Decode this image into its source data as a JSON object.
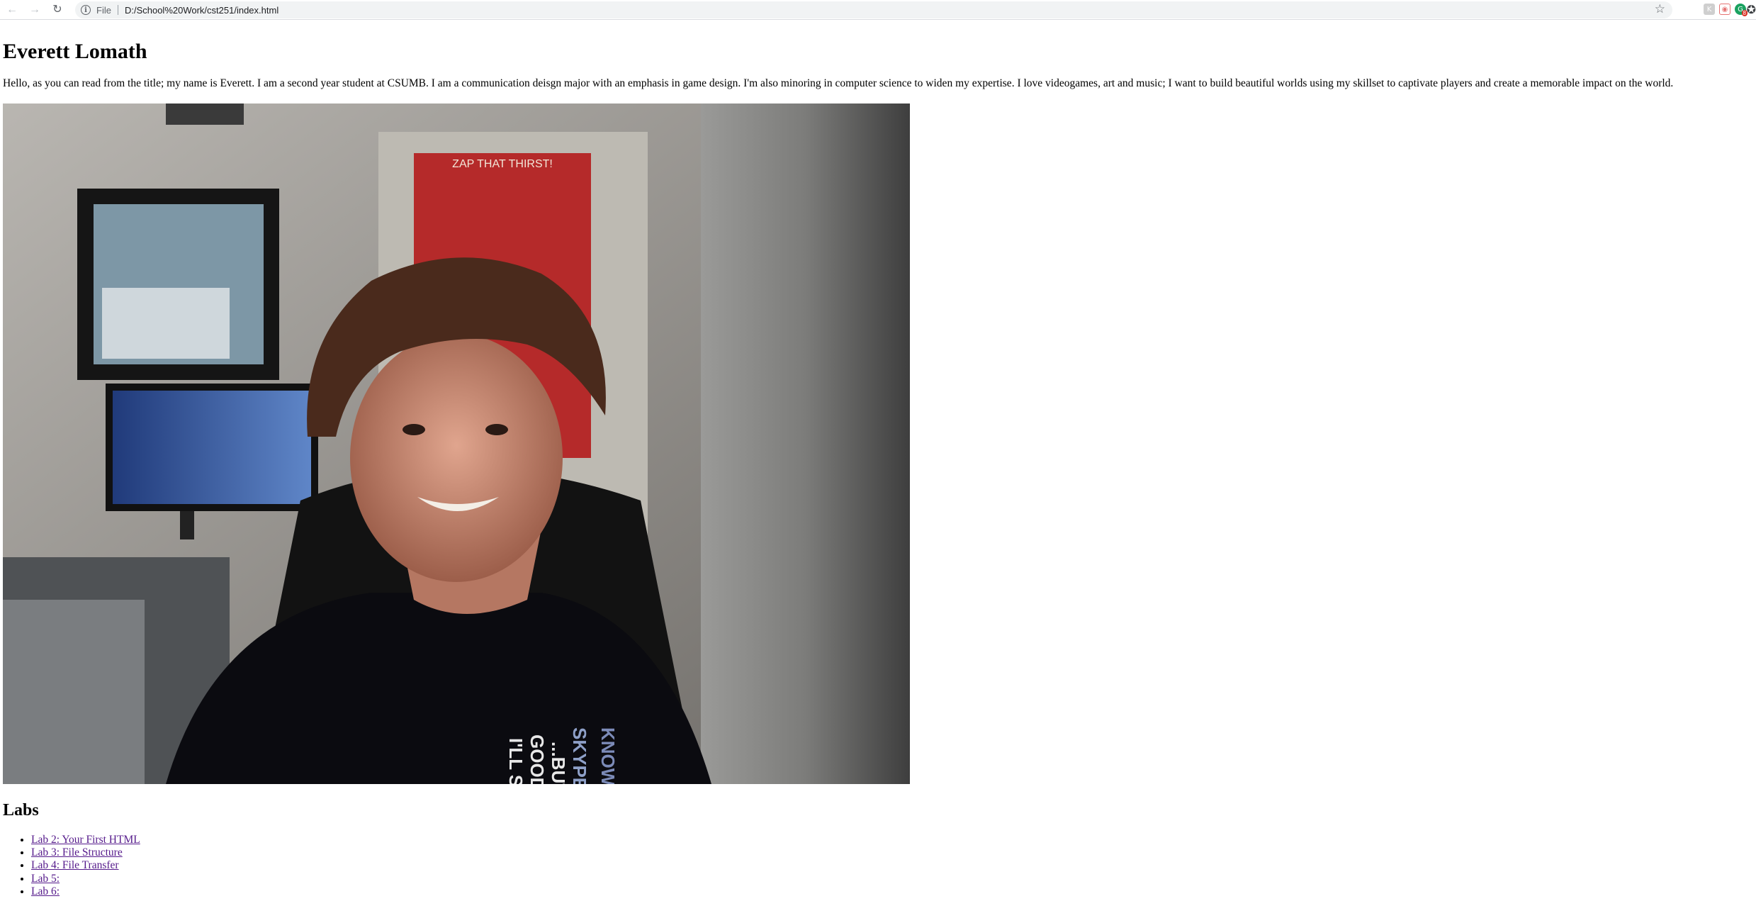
{
  "browser": {
    "scheme_label": "File",
    "url": "D:/School%20Work/cst251/index.html",
    "icons": {
      "back": "arrow-left-icon",
      "forward": "arrow-right-icon",
      "reload": "reload-icon",
      "info": "info-icon",
      "bookmark": "star-icon",
      "extensions": "puzzle-icon"
    },
    "extension_badge": "8"
  },
  "page": {
    "title": "Everett Lomath",
    "intro": "Hello, as you can read from the title; my name is Everett. I am a second year student at CSUMB. I am a communication deisgn major with an emphasis in game design. I'm also minoring in computer science to widen my expertise. I love videogames, art and music; I want to build beautiful worlds using my skillset to captivate players and create a memorable impact on the world.",
    "photo_text": {
      "poster": "ZAP THAT THIRST!",
      "shirt": [
        "KNOW",
        "SKYPE T",
        "...BUT T",
        "GOODN",
        "I'LL SE"
      ]
    },
    "labs_heading": "Labs",
    "labs": [
      {
        "label": "Lab 2: Your First HTML"
      },
      {
        "label": "Lab 3: File Structure"
      },
      {
        "label": "Lab 4: File Transfer"
      },
      {
        "label": "Lab 5:"
      },
      {
        "label": "Lab 6:"
      }
    ]
  },
  "colors": {
    "link_visited": "#551a8b",
    "chrome_bg": "#f1f3f4"
  }
}
